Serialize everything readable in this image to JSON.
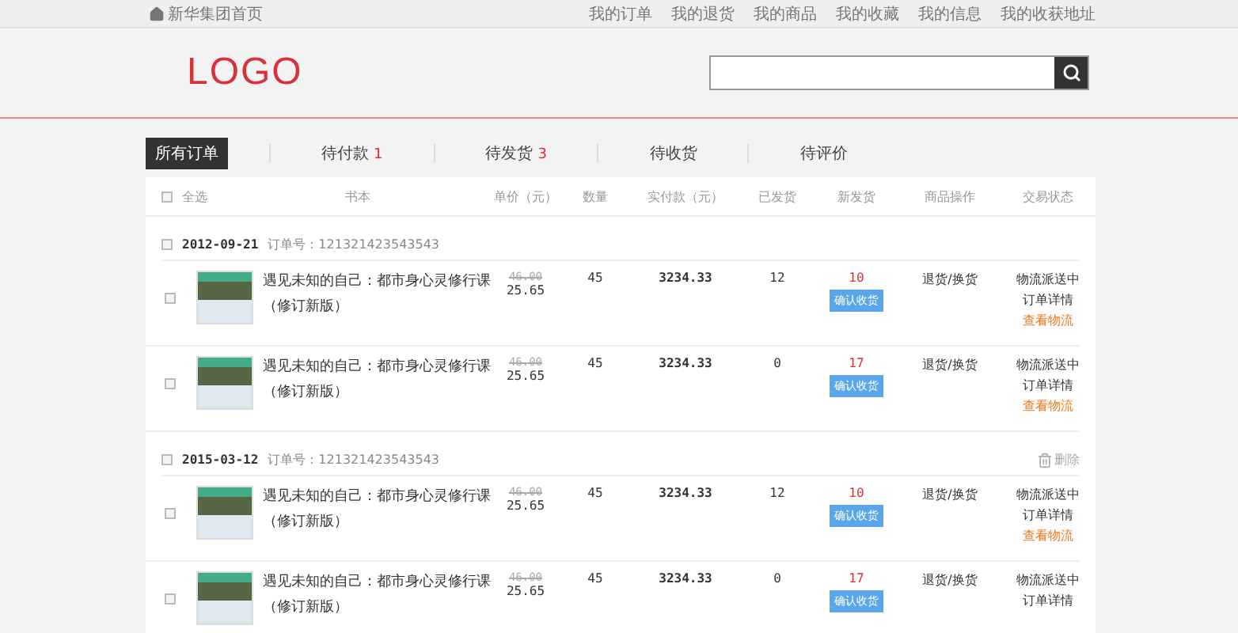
{
  "top_nav": {
    "home": "新华集团首页",
    "links": [
      "我的订单",
      "我的退货",
      "我的商品",
      "我的收藏",
      "我的信息",
      "我的收获地址"
    ]
  },
  "logo": "LOGO",
  "tabs": [
    {
      "label": "所有订单",
      "selected": true
    },
    {
      "label": "待付款",
      "count": "1",
      "selected": false
    },
    {
      "label": "待发货",
      "count": "3",
      "selected": false
    },
    {
      "label": "待收货",
      "selected": false
    },
    {
      "label": "待评价",
      "selected": false
    }
  ],
  "table": {
    "select_all": {
      "label": "全选",
      "checked": false
    },
    "columns": [
      "书本",
      "单价（元）",
      "数量",
      "实付款（元）",
      "已发货",
      "新发货",
      "商品操作",
      "交易状态"
    ],
    "orders": [
      {
        "date": "2012-09-21",
        "order_no": "订单号：121321423543543",
        "checked": false,
        "items": [
          {
            "checked": false,
            "title": "遇见未知的自己：都市身心灵修行课",
            "edition": "（修订新版）",
            "original_price": "46.00",
            "price": "25.65",
            "quantity": "45",
            "paid": "3234.33",
            "shipped": "12",
            "new_shipped": "10",
            "confirm": "确认收货",
            "operation": "退货/换货",
            "status": "物流派送中",
            "detail_link": "订单详情",
            "logistics_link": "查看物流"
          },
          {
            "checked": false,
            "title": "遇见未知的自己：都市身心灵修行课",
            "edition": "（修订新版）",
            "original_price": "46.00",
            "price": "25.65",
            "quantity": "45",
            "paid": "3234.33",
            "shipped": "0",
            "new_shipped": "17",
            "confirm": "确认收货",
            "operation": "退货/换货",
            "status": "物流派送中",
            "detail_link": "订单详情",
            "logistics_link": "查看物流"
          }
        ]
      },
      {
        "date": "2015-03-12",
        "order_no": "订单号：121321423543543",
        "checked": false,
        "delete": "删除",
        "items": [
          {
            "checked": false,
            "title": "遇见未知的自己：都市身心灵修行课",
            "edition": "（修订新版）",
            "original_price": "46.00",
            "price": "25.65",
            "quantity": "45",
            "paid": "3234.33",
            "shipped": "12",
            "new_shipped": "10",
            "confirm": "确认收货",
            "operation": "退货/换货",
            "status": "物流派送中",
            "detail_link": "订单详情",
            "logistics_link": "查看物流"
          },
          {
            "checked": false,
            "title": "遇见未知的自己：都市身心灵修行课",
            "edition": "（修订新版）",
            "original_price": "46.00",
            "price": "25.65",
            "quantity": "45",
            "paid": "3234.33",
            "shipped": "0",
            "new_shipped": "17",
            "confirm": "确认收货",
            "operation": "退货/换货",
            "status": "物流派送中",
            "detail_link": "订单详情"
          }
        ]
      }
    ]
  }
}
